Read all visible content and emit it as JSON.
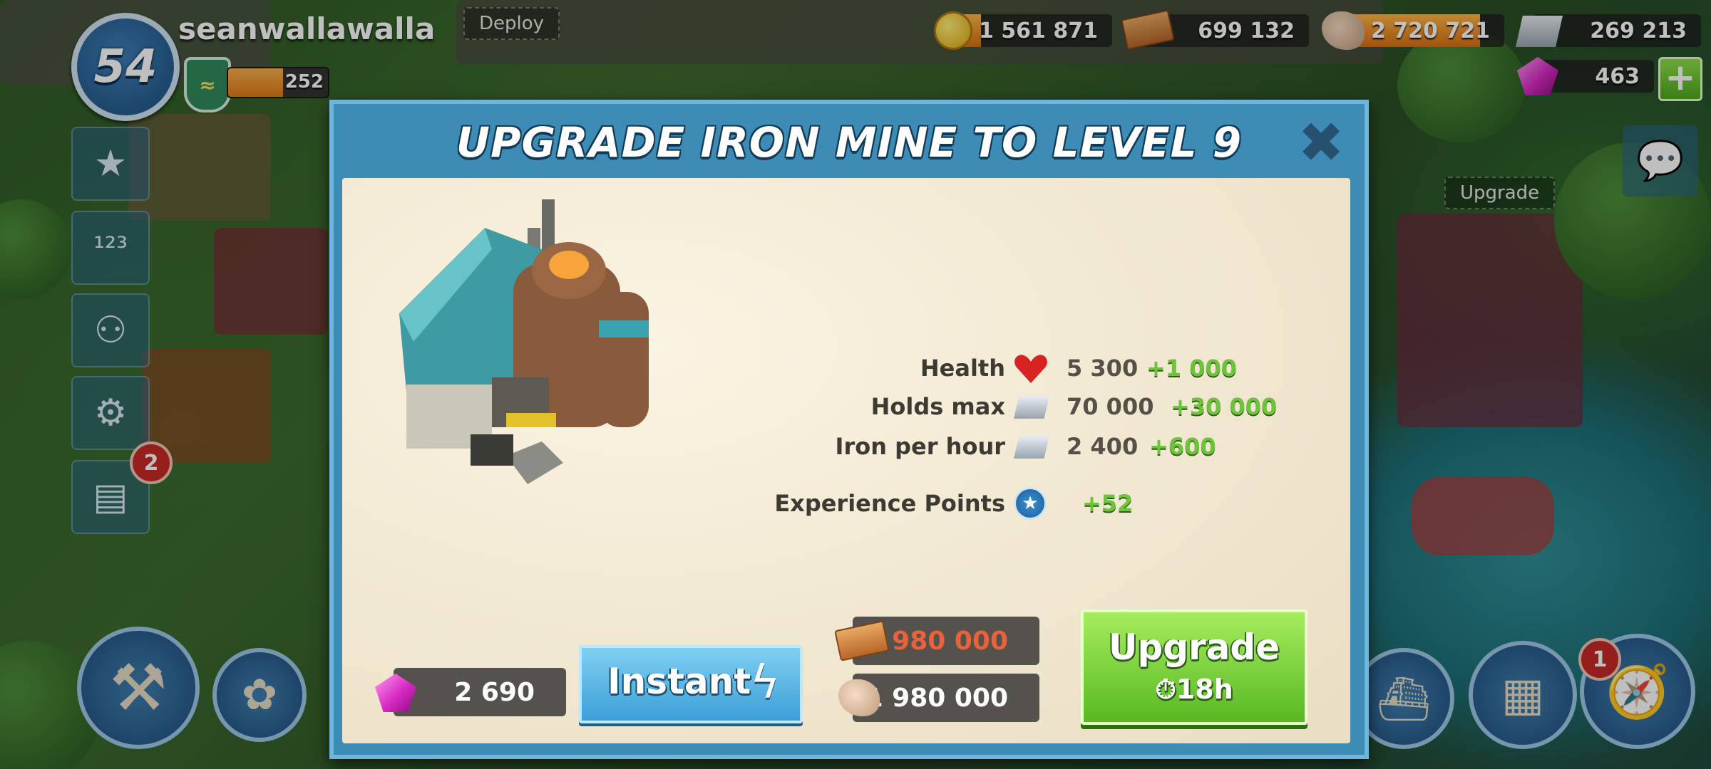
{
  "player": {
    "level": "54",
    "username": "seanwallawalla",
    "rank_points": "252",
    "rank_progress": 0.55
  },
  "resources": {
    "gold": {
      "amount": "1 561 871",
      "fill": 0.2,
      "icon": "gold-coin-icon"
    },
    "wood": {
      "amount": "699 132",
      "fill": 0.0,
      "icon": "wood-icon"
    },
    "stone": {
      "amount": "2 720 721",
      "fill": 0.85,
      "icon": "stone-icon"
    },
    "iron": {
      "amount": "269 213",
      "fill": 0.0,
      "icon": "iron-icon"
    },
    "diamonds": {
      "amount": "463",
      "icon": "diamond-icon"
    }
  },
  "world": {
    "deploy_label": "Deploy",
    "upgrade_label": "Upgrade",
    "news_badge": "2",
    "map_badge": "1"
  },
  "modal": {
    "title": "UPGRADE IRON MINE TO LEVEL 9",
    "stats": [
      {
        "label": "Health",
        "icon": "heart-icon",
        "value": "5 300",
        "bonus": "+1 000"
      },
      {
        "label": "Holds max",
        "icon": "iron-icon",
        "value": "70 000",
        "bonus": "+30 000"
      },
      {
        "label": "Iron per hour",
        "icon": "iron-icon",
        "value": "2 400",
        "bonus": "+600"
      },
      {
        "label": "Experience Points",
        "icon": "xp-star-icon",
        "value": "",
        "bonus": "+52"
      }
    ],
    "instant": {
      "diamond_cost": "2 690",
      "label": "Instant"
    },
    "costs": {
      "wood": "1 980 000",
      "stone": "1 980 000"
    },
    "upgrade": {
      "label": "Upgrade",
      "time": "18h"
    }
  },
  "colors": {
    "insufficient": "#e8623c",
    "sufficient": "#ffffff",
    "bonus": "#6dc43c",
    "modal_frame": "#3c8cb6",
    "upgrade_green": "#58b823",
    "instant_blue": "#3d9fd8"
  }
}
